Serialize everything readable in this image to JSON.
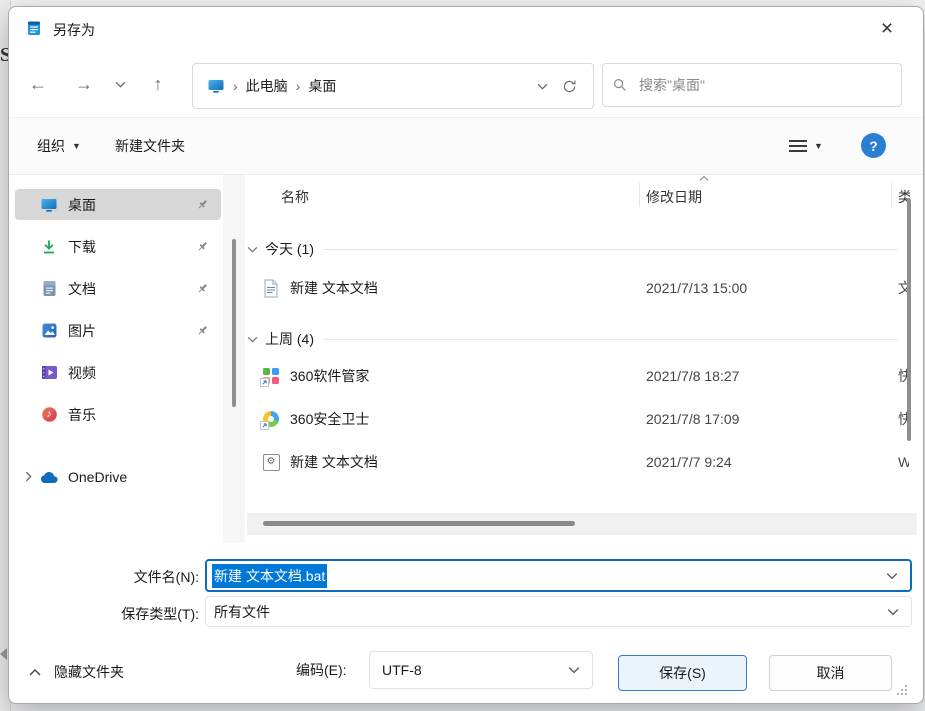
{
  "colors": {
    "accent": "#0078d7",
    "selection_bg": "#0078d7",
    "save_button_border": "#2f7fd0",
    "help_icon_bg": "#2a7fd4",
    "sidebar_selected_bg": "#d7d7d7"
  },
  "icons": {
    "back": "←",
    "forward": "→",
    "up": "↑",
    "close": "×",
    "crumb_sep": "›",
    "caret_down": "▼",
    "music_note": "♪",
    "gear": "⚙",
    "help": "?"
  },
  "background": {
    "fragment": "S"
  },
  "window": {
    "title": "另存为"
  },
  "nav": {
    "breadcrumb": {
      "items": [
        "此电脑",
        "桌面"
      ]
    },
    "search_placeholder": "搜索\"桌面\""
  },
  "toolbar": {
    "organize": "组织",
    "new_folder": "新建文件夹"
  },
  "sidebar": {
    "items": [
      {
        "label": "桌面",
        "selected": true,
        "pinned": true
      },
      {
        "label": "下载",
        "pinned": true
      },
      {
        "label": "文档",
        "pinned": true
      },
      {
        "label": "图片",
        "pinned": true
      },
      {
        "label": "视频"
      },
      {
        "label": "音乐"
      },
      {
        "label": "OneDrive",
        "expandable": true
      }
    ]
  },
  "filelist": {
    "columns": {
      "name": "名称",
      "date": "修改日期",
      "type": "类"
    },
    "groups": [
      {
        "label": "今天 (1)",
        "rows": [
          {
            "name": "新建 文本文档",
            "icon": "text-file-icon",
            "date": "2021/7/13 15:00",
            "type": "文"
          }
        ]
      },
      {
        "label": "上周 (4)",
        "rows": [
          {
            "name": "360软件管家",
            "icon": "360-software-manager-icon",
            "date": "2021/7/8 18:27",
            "type": "快"
          },
          {
            "name": "360安全卫士",
            "icon": "360-safe-guard-icon",
            "date": "2021/7/8 17:09",
            "type": "快"
          },
          {
            "name": "新建 文本文档",
            "icon": "batch-file-icon",
            "date": "2021/7/7 9:24",
            "type": "W"
          }
        ]
      }
    ]
  },
  "fields": {
    "filename_label": "文件名(N):",
    "filename_value": "新建 文本文档.bat",
    "type_label": "保存类型(T):",
    "type_value": "所有文件",
    "encoding_label": "编码(E):",
    "encoding_value": "UTF-8"
  },
  "footer": {
    "hide_folders": "隐藏文件夹",
    "save": "保存(S)",
    "cancel": "取消"
  }
}
